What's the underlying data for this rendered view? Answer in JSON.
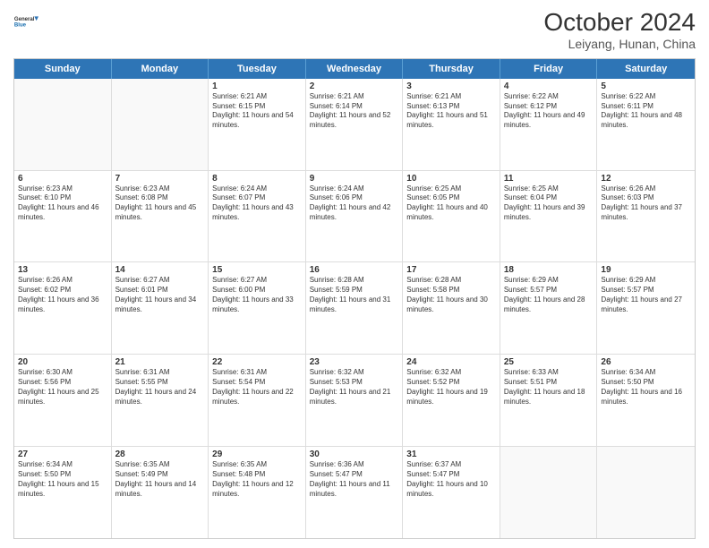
{
  "logo": {
    "line1": "General",
    "line2": "Blue"
  },
  "title": "October 2024",
  "subtitle": "Leiyang, Hunan, China",
  "days": [
    "Sunday",
    "Monday",
    "Tuesday",
    "Wednesday",
    "Thursday",
    "Friday",
    "Saturday"
  ],
  "weeks": [
    [
      {
        "day": "",
        "info": ""
      },
      {
        "day": "",
        "info": ""
      },
      {
        "day": "1",
        "info": "Sunrise: 6:21 AM\nSunset: 6:15 PM\nDaylight: 11 hours and 54 minutes."
      },
      {
        "day": "2",
        "info": "Sunrise: 6:21 AM\nSunset: 6:14 PM\nDaylight: 11 hours and 52 minutes."
      },
      {
        "day": "3",
        "info": "Sunrise: 6:21 AM\nSunset: 6:13 PM\nDaylight: 11 hours and 51 minutes."
      },
      {
        "day": "4",
        "info": "Sunrise: 6:22 AM\nSunset: 6:12 PM\nDaylight: 11 hours and 49 minutes."
      },
      {
        "day": "5",
        "info": "Sunrise: 6:22 AM\nSunset: 6:11 PM\nDaylight: 11 hours and 48 minutes."
      }
    ],
    [
      {
        "day": "6",
        "info": "Sunrise: 6:23 AM\nSunset: 6:10 PM\nDaylight: 11 hours and 46 minutes."
      },
      {
        "day": "7",
        "info": "Sunrise: 6:23 AM\nSunset: 6:08 PM\nDaylight: 11 hours and 45 minutes."
      },
      {
        "day": "8",
        "info": "Sunrise: 6:24 AM\nSunset: 6:07 PM\nDaylight: 11 hours and 43 minutes."
      },
      {
        "day": "9",
        "info": "Sunrise: 6:24 AM\nSunset: 6:06 PM\nDaylight: 11 hours and 42 minutes."
      },
      {
        "day": "10",
        "info": "Sunrise: 6:25 AM\nSunset: 6:05 PM\nDaylight: 11 hours and 40 minutes."
      },
      {
        "day": "11",
        "info": "Sunrise: 6:25 AM\nSunset: 6:04 PM\nDaylight: 11 hours and 39 minutes."
      },
      {
        "day": "12",
        "info": "Sunrise: 6:26 AM\nSunset: 6:03 PM\nDaylight: 11 hours and 37 minutes."
      }
    ],
    [
      {
        "day": "13",
        "info": "Sunrise: 6:26 AM\nSunset: 6:02 PM\nDaylight: 11 hours and 36 minutes."
      },
      {
        "day": "14",
        "info": "Sunrise: 6:27 AM\nSunset: 6:01 PM\nDaylight: 11 hours and 34 minutes."
      },
      {
        "day": "15",
        "info": "Sunrise: 6:27 AM\nSunset: 6:00 PM\nDaylight: 11 hours and 33 minutes."
      },
      {
        "day": "16",
        "info": "Sunrise: 6:28 AM\nSunset: 5:59 PM\nDaylight: 11 hours and 31 minutes."
      },
      {
        "day": "17",
        "info": "Sunrise: 6:28 AM\nSunset: 5:58 PM\nDaylight: 11 hours and 30 minutes."
      },
      {
        "day": "18",
        "info": "Sunrise: 6:29 AM\nSunset: 5:57 PM\nDaylight: 11 hours and 28 minutes."
      },
      {
        "day": "19",
        "info": "Sunrise: 6:29 AM\nSunset: 5:57 PM\nDaylight: 11 hours and 27 minutes."
      }
    ],
    [
      {
        "day": "20",
        "info": "Sunrise: 6:30 AM\nSunset: 5:56 PM\nDaylight: 11 hours and 25 minutes."
      },
      {
        "day": "21",
        "info": "Sunrise: 6:31 AM\nSunset: 5:55 PM\nDaylight: 11 hours and 24 minutes."
      },
      {
        "day": "22",
        "info": "Sunrise: 6:31 AM\nSunset: 5:54 PM\nDaylight: 11 hours and 22 minutes."
      },
      {
        "day": "23",
        "info": "Sunrise: 6:32 AM\nSunset: 5:53 PM\nDaylight: 11 hours and 21 minutes."
      },
      {
        "day": "24",
        "info": "Sunrise: 6:32 AM\nSunset: 5:52 PM\nDaylight: 11 hours and 19 minutes."
      },
      {
        "day": "25",
        "info": "Sunrise: 6:33 AM\nSunset: 5:51 PM\nDaylight: 11 hours and 18 minutes."
      },
      {
        "day": "26",
        "info": "Sunrise: 6:34 AM\nSunset: 5:50 PM\nDaylight: 11 hours and 16 minutes."
      }
    ],
    [
      {
        "day": "27",
        "info": "Sunrise: 6:34 AM\nSunset: 5:50 PM\nDaylight: 11 hours and 15 minutes."
      },
      {
        "day": "28",
        "info": "Sunrise: 6:35 AM\nSunset: 5:49 PM\nDaylight: 11 hours and 14 minutes."
      },
      {
        "day": "29",
        "info": "Sunrise: 6:35 AM\nSunset: 5:48 PM\nDaylight: 11 hours and 12 minutes."
      },
      {
        "day": "30",
        "info": "Sunrise: 6:36 AM\nSunset: 5:47 PM\nDaylight: 11 hours and 11 minutes."
      },
      {
        "day": "31",
        "info": "Sunrise: 6:37 AM\nSunset: 5:47 PM\nDaylight: 11 hours and 10 minutes."
      },
      {
        "day": "",
        "info": ""
      },
      {
        "day": "",
        "info": ""
      }
    ]
  ]
}
